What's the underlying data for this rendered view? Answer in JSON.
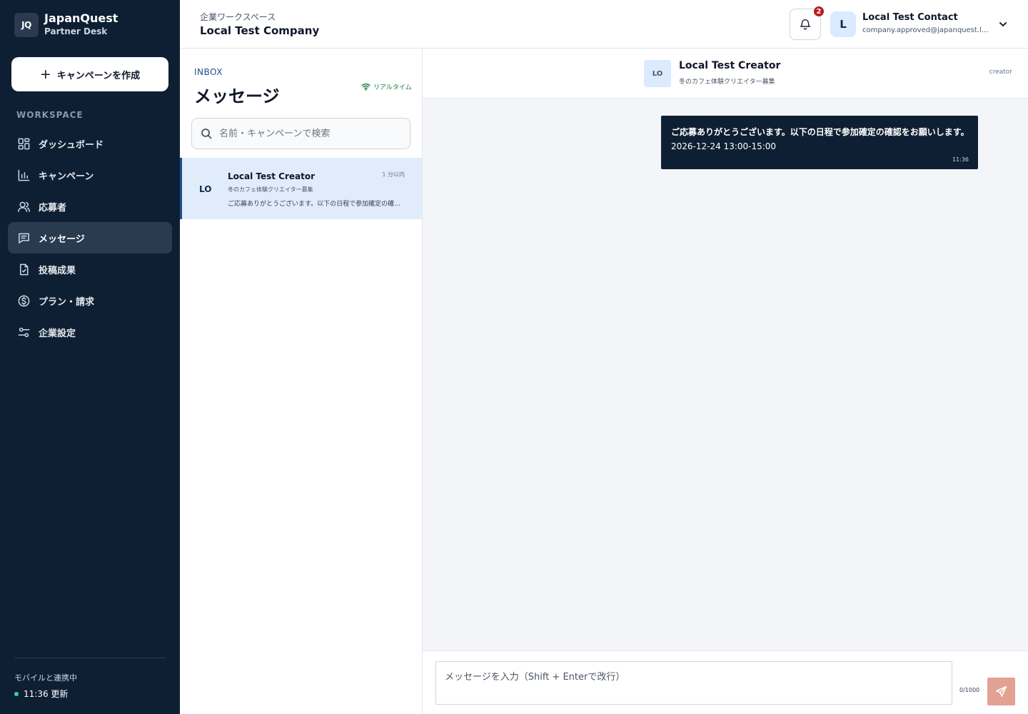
{
  "brand": {
    "logo": "JQ",
    "name": "JapanQuest",
    "subtitle": "Partner Desk"
  },
  "sidebar": {
    "create_button": "キャンペーンを作成",
    "section_label": "WORKSPACE",
    "items": [
      {
        "label": "ダッシュボード",
        "icon": "dashboard-icon",
        "active": false
      },
      {
        "label": "キャンペーン",
        "icon": "bar-chart-icon",
        "active": false
      },
      {
        "label": "応募者",
        "icon": "users-icon",
        "active": false
      },
      {
        "label": "メッセージ",
        "icon": "message-icon",
        "active": true
      },
      {
        "label": "投稿成果",
        "icon": "document-icon",
        "active": false
      },
      {
        "label": "プラン・請求",
        "icon": "dollar-icon",
        "active": false
      },
      {
        "label": "企業設定",
        "icon": "settings-sliders-icon",
        "active": false
      }
    ],
    "sync_label": "モバイルと連携中",
    "sync_status": "11:36 更新",
    "sync_color": "#34d399"
  },
  "header": {
    "workspace_label": "企業ワークスペース",
    "company_name": "Local Test Company",
    "notification_count": "2",
    "user": {
      "avatar": "L",
      "name": "Local Test Contact",
      "email": "company.approved@japanquest.local"
    }
  },
  "inbox": {
    "tag": "INBOX",
    "title": "メッセージ",
    "realtime_label": "リアルタイム",
    "search_placeholder": "名前・キャンペーンで検索",
    "conversations": [
      {
        "avatar": "LO",
        "name": "Local Test Creator",
        "time": "1 分以内",
        "campaign": "冬のカフェ体験クリエイター募集",
        "preview": "ご応募ありがとうございます。以下の日程で参加確定の確認をお願いします。"
      }
    ]
  },
  "chat": {
    "avatar": "LO",
    "name": "Local Test Creator",
    "campaign": "冬のカフェ体験クリエイター募集",
    "role": "creator",
    "messages": [
      {
        "line1": "ご応募ありがとうございます。以下の日程で参加確定の確認をお願いします。",
        "line2": "2026-12-24 13:00-15:00",
        "time": "11:36"
      }
    ],
    "composer_placeholder": "メッセージを入力（Shift + Enterで改行）",
    "char_count": "0/1000"
  },
  "colors": {
    "sidebar_bg": "#0f1f33",
    "accent": "#1d4f8c",
    "send_button": "#e2a193",
    "badge": "#b91c1c"
  }
}
